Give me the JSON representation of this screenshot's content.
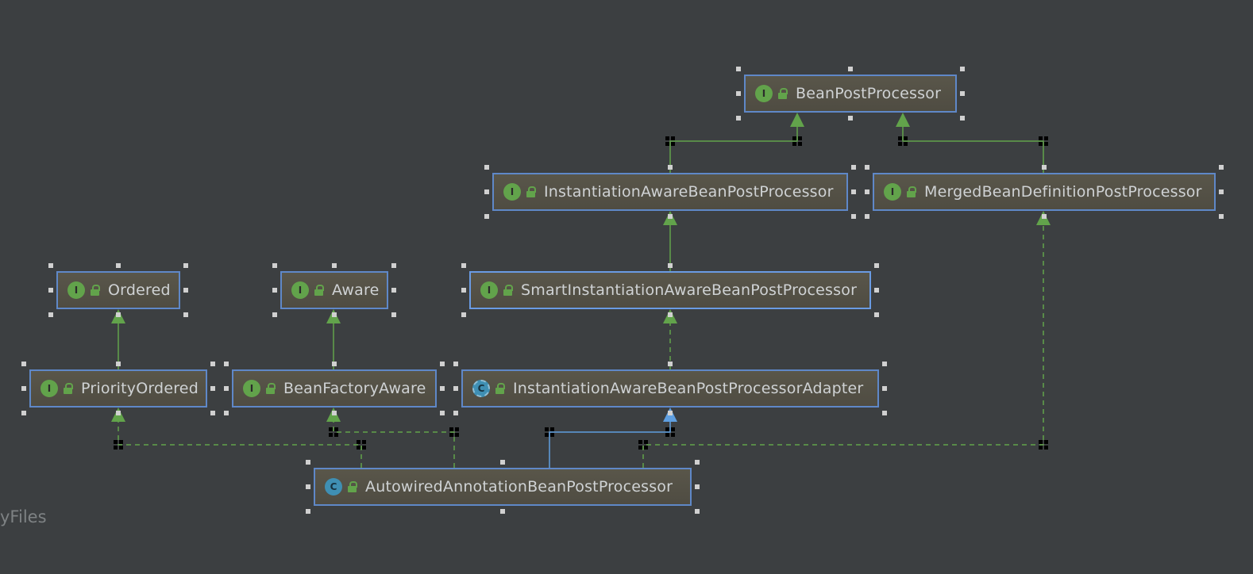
{
  "nodes": [
    {
      "id": "bpp",
      "label": "BeanPostProcessor",
      "kind": "I"
    },
    {
      "id": "iabpp",
      "label": "InstantiationAwareBeanPostProcessor",
      "kind": "I"
    },
    {
      "id": "mbdpp",
      "label": "MergedBeanDefinitionPostProcessor",
      "kind": "I"
    },
    {
      "id": "ordered",
      "label": "Ordered",
      "kind": "I"
    },
    {
      "id": "aware",
      "label": "Aware",
      "kind": "I"
    },
    {
      "id": "siabpp",
      "label": "SmartInstantiationAwareBeanPostProcessor",
      "kind": "I"
    },
    {
      "id": "prio",
      "label": "PriorityOrdered",
      "kind": "I"
    },
    {
      "id": "bfa",
      "label": "BeanFactoryAware",
      "kind": "I"
    },
    {
      "id": "iabppa",
      "label": "InstantiationAwareBeanPostProcessorAdapter",
      "kind": "C"
    },
    {
      "id": "aabpp",
      "label": "AutowiredAnnotationBeanPostProcessor",
      "kind": "C"
    }
  ],
  "watermark": "yFiles",
  "colors": {
    "background": "#3c3f41",
    "border": "#5f88c8",
    "interfaceIcon": "#62a34b",
    "classIcon": "#3f8fb3",
    "extendsEdge": "#62a34b",
    "implementsEdge": "#62a34b",
    "classEdge": "#5f9fe0"
  }
}
